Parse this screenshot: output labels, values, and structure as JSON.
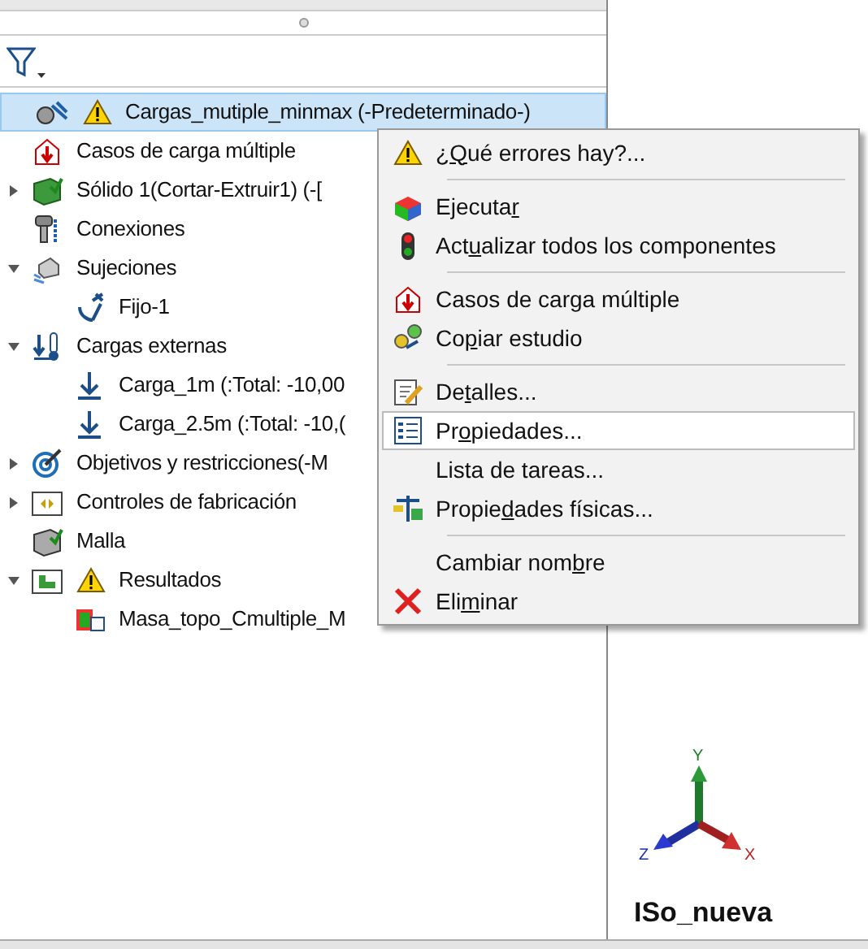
{
  "tree": {
    "items": [
      {
        "label": "Cargas_mutiple_minmax (-Predeterminado-)",
        "selected": true,
        "warning": true
      },
      {
        "label": "Casos de carga múltiple",
        "selected": false
      },
      {
        "label": "Sólido 1(Cortar-Extruir1) (-[",
        "selected": false,
        "expanded": false
      },
      {
        "label": "Conexiones",
        "selected": false
      },
      {
        "label": "Sujeciones",
        "selected": false,
        "expanded": true,
        "children": [
          {
            "label": "Fijo-1",
            "selected": false
          }
        ]
      },
      {
        "label": "Cargas externas",
        "selected": false,
        "expanded": true,
        "children": [
          {
            "label": "Carga_1m (:Total: -10,00",
            "selected": false
          },
          {
            "label": "Carga_2.5m (:Total: -10,(",
            "selected": false
          }
        ]
      },
      {
        "label": "Objetivos y restricciones(-M",
        "selected": false,
        "expanded": false
      },
      {
        "label": "Controles de fabricación",
        "selected": false,
        "expanded": false
      },
      {
        "label": "Malla",
        "selected": false
      },
      {
        "label": "Resultados",
        "selected": false,
        "expanded": true,
        "warning": true,
        "children": [
          {
            "label": "Masa_topo_Cmultiple_M",
            "selected": false
          }
        ]
      }
    ]
  },
  "context_menu": {
    "items": [
      {
        "kind": "item",
        "before": "¿",
        "key": "Q",
        "after": "ué errores hay?...",
        "selected": false
      },
      {
        "kind": "separator"
      },
      {
        "kind": "item",
        "before": "Ejecuta",
        "key": "r",
        "selected": false
      },
      {
        "kind": "item",
        "before": "Act",
        "key": "u",
        "after": "alizar todos los componentes",
        "selected": false
      },
      {
        "kind": "separator"
      },
      {
        "kind": "item",
        "before": "Casos de carga múltiple",
        "selected": false
      },
      {
        "kind": "item",
        "before": "Co",
        "key": "p",
        "after": "iar estudio",
        "selected": false
      },
      {
        "kind": "separator"
      },
      {
        "kind": "item",
        "before": "De",
        "key": "t",
        "after": "alles...",
        "selected": false
      },
      {
        "kind": "item",
        "before": "Pr",
        "key": "o",
        "after": "piedades...",
        "selected": true
      },
      {
        "kind": "item",
        "before": "Lista de tareas...",
        "selected": false
      },
      {
        "kind": "item",
        "before": "Propie",
        "key": "d",
        "after": "ades físicas...",
        "selected": false
      },
      {
        "kind": "separator"
      },
      {
        "kind": "item",
        "before": "Cambiar nom",
        "key": "b",
        "after": "re",
        "selected": false
      },
      {
        "kind": "item",
        "before": "Eli",
        "key": "m",
        "after": "inar",
        "selected": false
      }
    ]
  },
  "triad": {
    "x": "X",
    "y": "Y",
    "z": "Z"
  },
  "view_name": "ISo_nueva"
}
